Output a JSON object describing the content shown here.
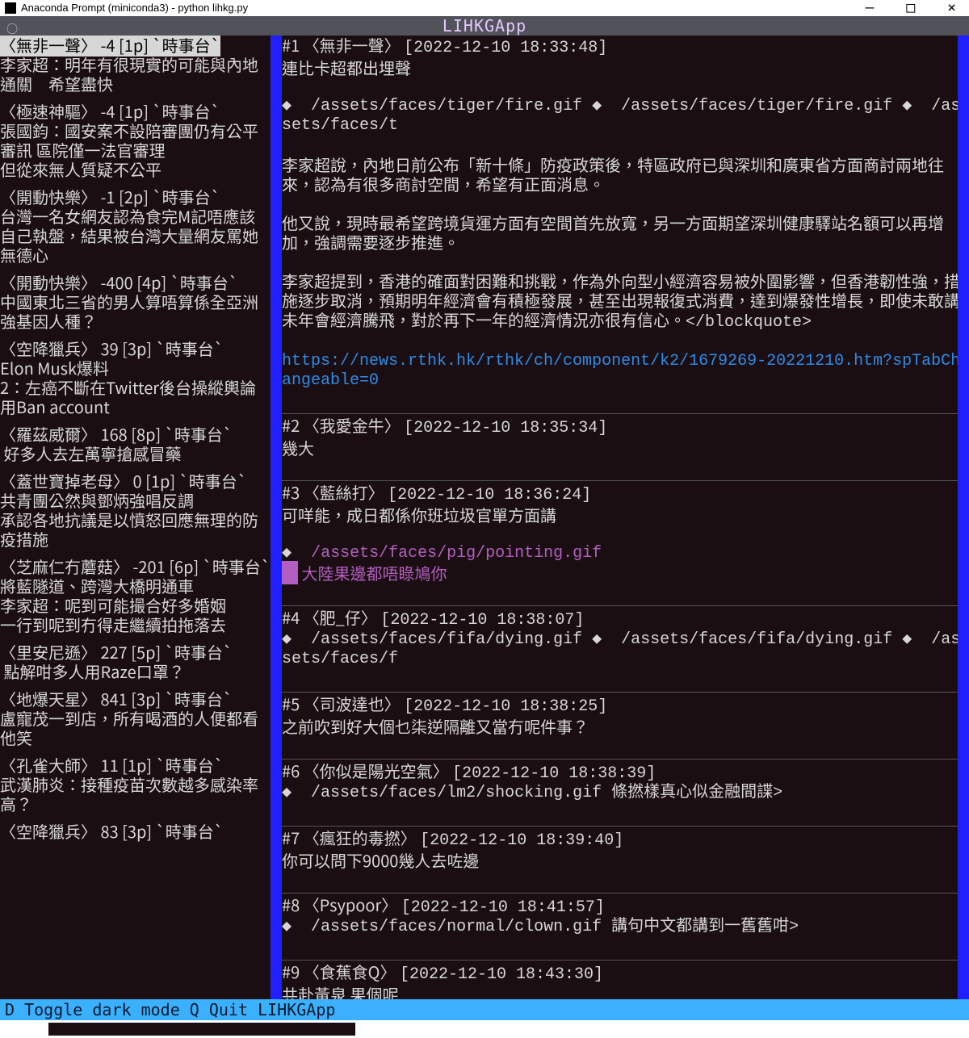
{
  "window": {
    "title": "Anaconda Prompt (miniconda3) - python  lihkg.py",
    "min": "—",
    "max": "□",
    "close": "×"
  },
  "app_title": "LIHKGApp",
  "circle": "○",
  "footer": "D  Toggle dark mode  Q  Quit LIHKGApp",
  "sidebar": [
    {
      "author": "無非一聲",
      "score": "-4",
      "pages": "[1p]",
      "board": "`時事台`",
      "title": "李家超：明年有很現實的可能與內地通關　希望盡快",
      "selected": true
    },
    {
      "author": "極速神驅",
      "score": "-4",
      "pages": "[1p]",
      "board": "`時事台`",
      "title": "張國鈞：國安案不設陪審團仍有公平審訊 區院僅一法官審理\n但從來無人質疑不公平"
    },
    {
      "author": "開動快樂",
      "score": "-1",
      "pages": "[2p]",
      "board": "`時事台`",
      "title": "台灣一名女網友認為食完M記唔應該自己執盤，結果被台灣大量網友罵她無德心"
    },
    {
      "author": "開動快樂",
      "score": "-400",
      "pages": "[4p]",
      "board": "`時事台`",
      "title": "中國東北三省的男人算唔算係全亞洲強基因人種？"
    },
    {
      "author": "空降獵兵",
      "score": "39",
      "pages": "[3p]",
      "board": "`時事台`",
      "title": "Elon Musk爆料\n2：左癌不斷在Twitter後台操縱輿論用Ban account"
    },
    {
      "author": "羅茲威爾",
      "score": "168",
      "pages": "[8p]",
      "board": "`時事台`",
      "title": " 好多人去左萬寧搶感冒藥"
    },
    {
      "author": "蓋世寶掉老母",
      "score": "0",
      "pages": "[1p]",
      "board": "`時事台`",
      "title": "共青團公然與鄧炳強唱反調\n承認各地抗議是以憤怒回應無理的防疫措施"
    },
    {
      "author": "芝麻仁冇蘑菇",
      "score": "-201",
      "pages": "[6p]",
      "board": "`時事台`",
      "title": "將藍隧道、跨灣大橋明通車\n李家超：呢到可能撮合好多婚姻\n一行到呢到冇得走繼續拍拖落去"
    },
    {
      "author": "里安尼遜",
      "score": "227",
      "pages": "[5p]",
      "board": "`時事台`",
      "title": " 點解咁多人用Raze口罩？"
    },
    {
      "author": "地爆天星",
      "score": "841",
      "pages": "[3p]",
      "board": "`時事台`",
      "title": "盧寵茂一到店，所有喝酒的人便都看他笑"
    },
    {
      "author": "孔雀大師",
      "score": "11",
      "pages": "[1p]",
      "board": "`時事台`",
      "title": "武漢肺炎：接種疫苗次數越多感染率高？"
    },
    {
      "author": "空降獵兵",
      "score": "83",
      "pages": "[3p]",
      "board": "`時事台`",
      "title": ""
    }
  ],
  "posts": [
    {
      "id": "#1",
      "author": "無非一聲",
      "time": "[2022-12-10 18:33:48]",
      "lines": [
        {
          "t": "plain",
          "v": "連比卡超都出埋聲"
        },
        {
          "t": "blank"
        },
        {
          "t": "assets",
          "v": "◆  /assets/faces/tiger/fire.gif ◆  /assets/faces/tiger/fire.gif ◆  /assets/faces/t"
        },
        {
          "t": "blank"
        },
        {
          "t": "plain",
          "v": "李家超說，內地日前公布「新十條」防疫政策後，特區政府已與深圳和廣東省方面商討兩地往來，認為有很多商討空間，希望有正面消息。"
        },
        {
          "t": "blank"
        },
        {
          "t": "plain",
          "v": "他又說，現時最希望跨境貨運方面有空間首先放寬，另一方面期望深圳健康驛站名額可以再增加，強調需要逐步推進。"
        },
        {
          "t": "blank"
        },
        {
          "t": "block",
          "v": "李家超提到，香港的確面對困難和挑戰，作為外向型小經濟容易被外圍影響，但香港韌性強，措施逐步取消，預期明年經濟會有積極發展，甚至出現報復式消費，達到爆發性增長，即使未敢講未年會經濟騰飛，對於再下一年的經濟情況亦很有信心。",
          "end": "</blockquote>"
        },
        {
          "t": "blank"
        },
        {
          "t": "link",
          "v": "https://news.rthk.hk/rthk/ch/component/k2/1679269-20221210.htm?spTabChangeable=0"
        }
      ]
    },
    {
      "id": "#2",
      "author": "我愛金牛",
      "time": "[2022-12-10 18:35:34]",
      "lines": [
        {
          "t": "plain",
          "v": "幾大"
        }
      ]
    },
    {
      "id": "#3",
      "author": "藍絲打",
      "time": "[2022-12-10 18:36:24]",
      "lines": [
        {
          "t": "plain",
          "v": "可咩能，成日都係你班垃圾官單方面講"
        },
        {
          "t": "blank"
        },
        {
          "t": "assets-purple",
          "v": "◆  /assets/faces/pig/pointing.gif"
        },
        {
          "t": "quote",
          "v": " 大陸果邊都唔睩鳩你"
        }
      ]
    },
    {
      "id": "#4",
      "author": "肥_仔",
      "time": "[2022-12-10 18:38:07]",
      "lines": [
        {
          "t": "assets",
          "v": "◆  /assets/faces/fifa/dying.gif ◆  /assets/faces/fifa/dying.gif ◆  /assets/faces/f"
        }
      ]
    },
    {
      "id": "#5",
      "author": "司波達也",
      "time": "[2022-12-10 18:38:25]",
      "lines": [
        {
          "t": "plain",
          "v": "之前吹到好大個乜柒逆隔離又當冇呢件事？"
        }
      ]
    },
    {
      "id": "#6",
      "author": "你似是陽光空氣",
      "time": "[2022-12-10 18:38:39]",
      "lines": [
        {
          "t": "assets",
          "v": "◆  /assets/faces/lm2/shocking.gif 條撚樣真心似金融間諜>"
        }
      ]
    },
    {
      "id": "#7",
      "author": "瘋狂的毒撚",
      "time": "[2022-12-10 18:39:40]",
      "lines": [
        {
          "t": "plain",
          "v": "你可以問下9000幾人去咗邊"
        }
      ]
    },
    {
      "id": "#8",
      "author": "Psypoor",
      "time": "[2022-12-10 18:41:57]",
      "lines": [
        {
          "t": "assets",
          "v": "◆  /assets/faces/normal/clown.gif 講句中文都講到一舊舊咁>"
        }
      ]
    },
    {
      "id": "#9",
      "author": "食蕉食Q",
      "time": "[2022-12-10 18:43:30]",
      "lines": [
        {
          "t": "plain",
          "v": "共赴黃泉 果個呢"
        }
      ]
    }
  ]
}
